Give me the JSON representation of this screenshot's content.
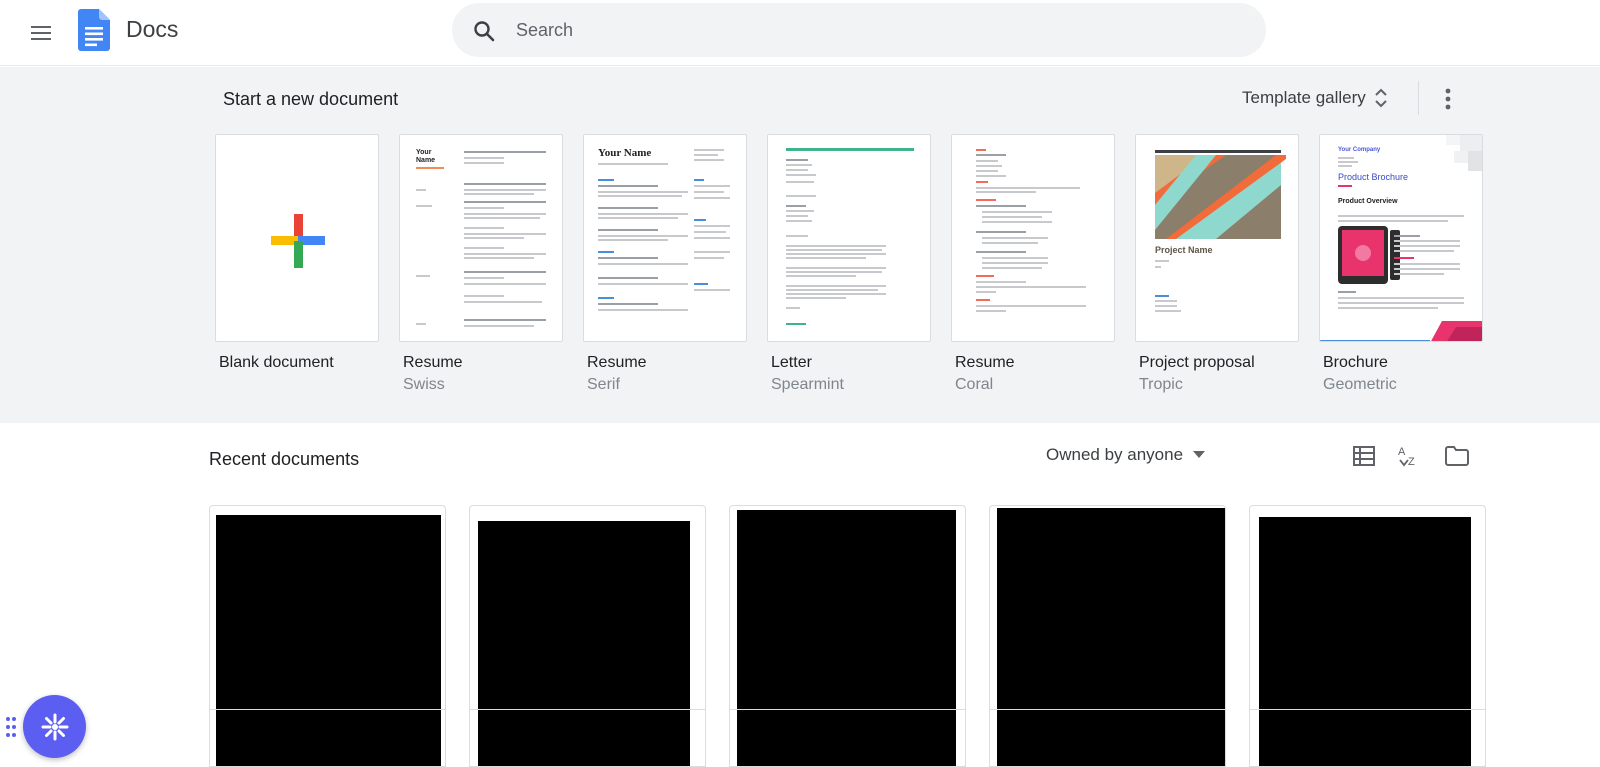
{
  "app": {
    "title": "Docs"
  },
  "search": {
    "placeholder": "Search"
  },
  "templates": {
    "heading": "Start a new document",
    "gallery_label": "Template gallery",
    "items": [
      {
        "name": "Blank document",
        "style": ""
      },
      {
        "name": "Resume",
        "style": "Swiss"
      },
      {
        "name": "Resume",
        "style": "Serif"
      },
      {
        "name": "Letter",
        "style": "Spearmint"
      },
      {
        "name": "Resume",
        "style": "Coral"
      },
      {
        "name": "Project proposal",
        "style": "Tropic"
      },
      {
        "name": "Brochure",
        "style": "Geometric"
      }
    ],
    "thumb_text": {
      "swiss_name": "Your Name",
      "serif_name": "Your Name",
      "proposal_title": "Project Name",
      "brochure_company": "Your Company",
      "brochure_title": "Product Brochure",
      "brochure_section": "Product Overview"
    }
  },
  "recent": {
    "heading": "Recent documents",
    "owner_filter": "Owned by anyone",
    "documents": [
      {},
      {},
      {},
      {},
      {}
    ]
  },
  "colors": {
    "google_blue": "#4285f4",
    "google_red": "#ea4335",
    "google_yellow": "#fbbc04",
    "google_green": "#34a853",
    "band_bg": "#f1f3f4",
    "assistant": "#5b5ef0"
  },
  "icons": {
    "menu": "hamburger-menu-icon",
    "search": "search-icon",
    "sort": "unfold-more-icon",
    "more": "more-vert-icon",
    "list_view": "list-view-icon",
    "sort_az": "sort-az-icon",
    "folder": "folder-icon",
    "dropdown": "caret-down-icon"
  }
}
